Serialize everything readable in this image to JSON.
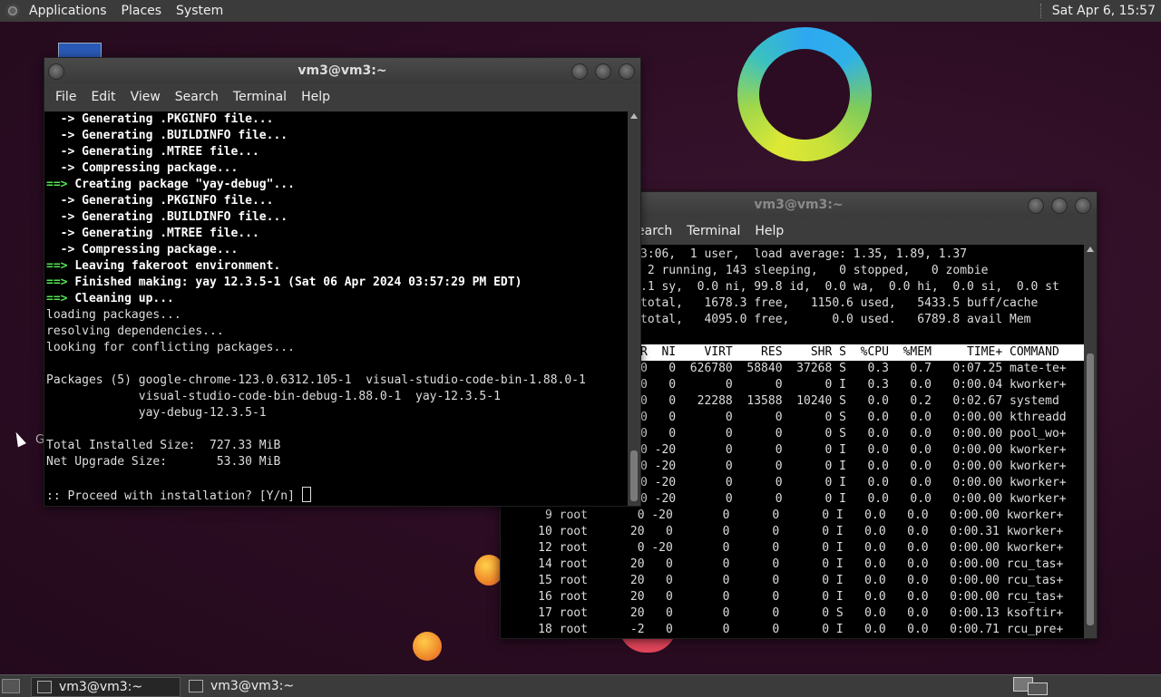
{
  "top_panel": {
    "menus": [
      "Applications",
      "Places",
      "System"
    ],
    "clock": "Sat Apr  6, 15:57"
  },
  "desktop": {
    "partial_icon_label": "G"
  },
  "win_front": {
    "title": "vm3@vm3:~",
    "menu": [
      "File",
      "Edit",
      "View",
      "Search",
      "Terminal",
      "Help"
    ],
    "lines": [
      {
        "p": "  -> ",
        "t": "Generating .PKGINFO file...",
        "s": "b"
      },
      {
        "p": "  -> ",
        "t": "Generating .BUILDINFO file...",
        "s": "b"
      },
      {
        "p": "  -> ",
        "t": "Generating .MTREE file...",
        "s": "b"
      },
      {
        "p": "  -> ",
        "t": "Compressing package...",
        "s": "b"
      },
      {
        "p": "==> ",
        "t": "Creating package \"yay-debug\"...",
        "s": "g"
      },
      {
        "p": "  -> ",
        "t": "Generating .PKGINFO file...",
        "s": "b"
      },
      {
        "p": "  -> ",
        "t": "Generating .BUILDINFO file...",
        "s": "b"
      },
      {
        "p": "  -> ",
        "t": "Generating .MTREE file...",
        "s": "b"
      },
      {
        "p": "  -> ",
        "t": "Compressing package...",
        "s": "b"
      },
      {
        "p": "==> ",
        "t": "Leaving fakeroot environment.",
        "s": "g"
      },
      {
        "p": "==> ",
        "t": "Finished making: yay 12.3.5-1 (Sat 06 Apr 2024 03:57:29 PM EDT)",
        "s": "g"
      },
      {
        "p": "==> ",
        "t": "Cleaning up...",
        "s": "g"
      },
      {
        "p": "",
        "t": "loading packages...",
        "s": "n"
      },
      {
        "p": "",
        "t": "resolving dependencies...",
        "s": "n"
      },
      {
        "p": "",
        "t": "looking for conflicting packages...",
        "s": "n"
      },
      {
        "p": "",
        "t": "",
        "s": "n"
      },
      {
        "p": "",
        "t": "Packages (5) google-chrome-123.0.6312.105-1  visual-studio-code-bin-1.88.0-1",
        "s": "n"
      },
      {
        "p": "",
        "t": "             visual-studio-code-bin-debug-1.88.0-1  yay-12.3.5-1",
        "s": "n"
      },
      {
        "p": "",
        "t": "             yay-debug-12.3.5-1",
        "s": "n"
      },
      {
        "p": "",
        "t": "",
        "s": "n"
      },
      {
        "p": "",
        "t": "Total Installed Size:  727.33 MiB",
        "s": "n"
      },
      {
        "p": "",
        "t": "Net Upgrade Size:       53.30 MiB",
        "s": "n"
      },
      {
        "p": "",
        "t": "",
        "s": "n"
      },
      {
        "p": "",
        "t": ":: Proceed with installation? [Y/n] ",
        "s": "n"
      }
    ]
  },
  "win_back": {
    "title": "vm3@vm3:~",
    "menu": [
      "earch",
      "Terminal",
      "Help"
    ],
    "summary": [
      "3:06,  1 user,  load average: 1.35, 1.89, 1.37",
      " 2 running, 143 sleeping,   0 stopped,   0 zombie",
      ".1 sy,  0.0 ni, 99.8 id,  0.0 wa,  0.0 hi,  0.0 si,  0.0 st",
      "total,   1678.3 free,   1150.6 used,   5433.5 buff/cache",
      "total,   4095.0 free,      0.0 used.   6789.8 avail Mem",
      ""
    ],
    "header": "R  NI    VIRT    RES    SHR S  %CPU  %MEM     TIME+ COMMAND",
    "rows_upper": [
      "0   0  626780  58840  37268 S   0.3   0.7   0:07.25 mate-te+",
      "0   0       0      0      0 I   0.3   0.0   0:00.04 kworker+",
      "0   0   22288  13588  10240 S   0.0   0.2   0:02.67 systemd",
      "0   0       0      0      0 S   0.0   0.0   0:00.00 kthreadd",
      "0   0       0      0      0 S   0.0   0.0   0:00.00 pool_wo+",
      "0 -20       0      0      0 I   0.0   0.0   0:00.00 kworker+",
      "0 -20       0      0      0 I   0.0   0.0   0:00.00 kworker+",
      "0 -20       0      0      0 I   0.0   0.0   0:00.00 kworker+",
      "0 -20       0      0      0 I   0.0   0.0   0:00.00 kworker+"
    ],
    "rows_lower": [
      "      9 root       0 -20       0      0      0 I   0.0   0.0   0:00.00 kworker+",
      "     10 root      20   0       0      0      0 I   0.0   0.0   0:00.31 kworker+",
      "     12 root       0 -20       0      0      0 I   0.0   0.0   0:00.00 kworker+",
      "     14 root      20   0       0      0      0 I   0.0   0.0   0:00.00 rcu_tas+",
      "     15 root      20   0       0      0      0 I   0.0   0.0   0:00.00 rcu_tas+",
      "     16 root      20   0       0      0      0 I   0.0   0.0   0:00.00 rcu_tas+",
      "     17 root      20   0       0      0      0 S   0.0   0.0   0:00.13 ksoftir+",
      "     18 root      -2   0       0      0      0 I   0.0   0.0   0:00.71 rcu_pre+"
    ]
  },
  "taskbar": {
    "tasks": [
      "vm3@vm3:~",
      "vm3@vm3:~"
    ]
  }
}
